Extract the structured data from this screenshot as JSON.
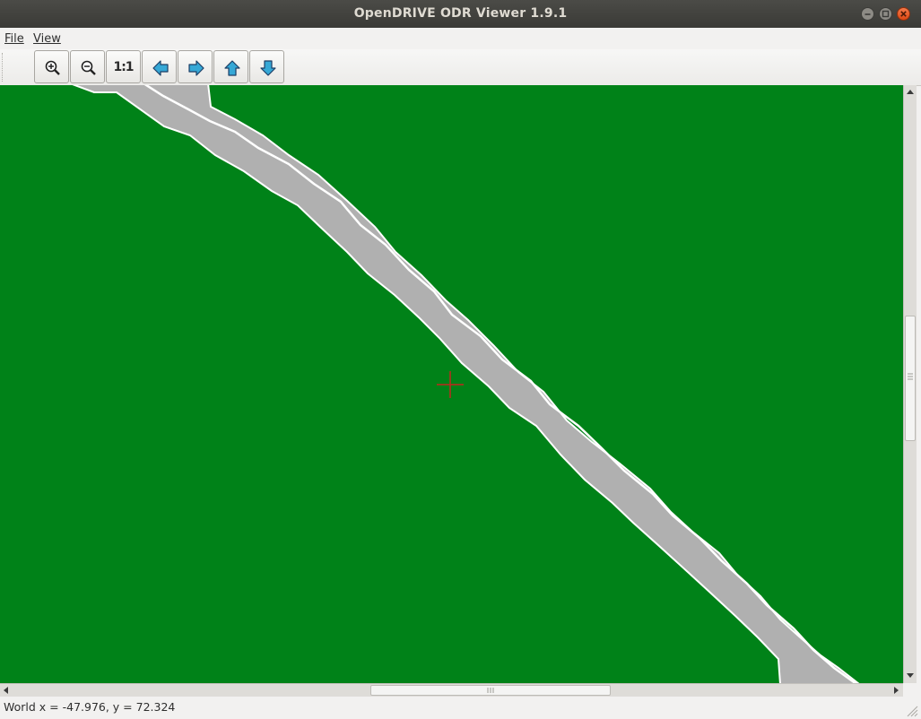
{
  "window": {
    "title": "OpenDRIVE ODR Viewer 1.9.1"
  },
  "menu": {
    "file_label": "File",
    "view_label": "View"
  },
  "toolbar": {
    "zoom_in_icon": "zoom-in-icon",
    "zoom_out_icon": "zoom-out-icon",
    "reset_zoom_label": "1:1",
    "pan_left_icon": "arrow-left-icon",
    "pan_right_icon": "arrow-right-icon",
    "pan_up_icon": "arrow-up-icon",
    "pan_down_icon": "arrow-down-icon"
  },
  "status": {
    "world_coords": "World x = -47.976, y = 72.324"
  },
  "colors": {
    "ground": "#008218",
    "road": "#b0b0b0",
    "lane_marking": "#ffffff",
    "crosshair": "#c0281e",
    "arrow_fill": "#36a8d6"
  }
}
